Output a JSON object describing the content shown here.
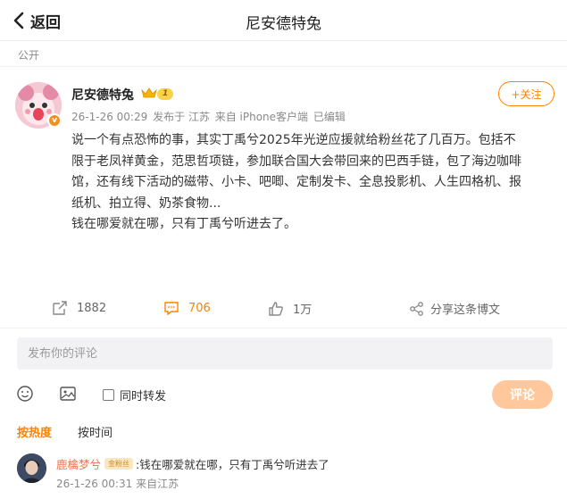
{
  "header": {
    "back_label": "返回",
    "title": "尼安德特兔"
  },
  "visibility": "公开",
  "post": {
    "author": "尼安德特兔",
    "level_badge": "1",
    "time": "26-1-26 00:29",
    "published_from": "发布于 江苏",
    "source": "来自 iPhone客户端",
    "edited": "已编辑",
    "follow_label": "+关注",
    "content_lines": [
      "说一个有点恐怖的事，其实丁禹兮2025年光逆应援就给粉丝花了几百万。包括不",
      "限于老凤祥黄金，范思哲项链，参加联合国大会带回来的巴西手链，包了海边咖啡",
      "馆，还有线下活动的磁带、小卡、吧唧、定制发卡、全息投影机、人生四格机、报",
      "纸机、拍立得、奶茶食物..."
    ],
    "content_last": "钱在哪爱就在哪，只有丁禹兮听进去了。"
  },
  "actions": {
    "repost_count": "1882",
    "comment_count": "706",
    "like_count": "1万",
    "share_label": "分享这条博文"
  },
  "comment_box": {
    "placeholder": "发布你的评论",
    "repost_checkbox_label": "同时转发",
    "submit_label": "评论"
  },
  "sort_tabs": {
    "hot": "按热度",
    "time": "按时间"
  },
  "comments": [
    {
      "user": "鹿檎梦兮",
      "fan_badge": "金粉丝",
      "text": ":钱在哪爱就在哪，只有丁禹兮听进去了",
      "time": "26-1-26 00:31",
      "source": "来自江苏"
    }
  ],
  "colors": {
    "accent": "#ff8200",
    "submit_disabled": "#ffc89c",
    "username": "#eb7350"
  }
}
